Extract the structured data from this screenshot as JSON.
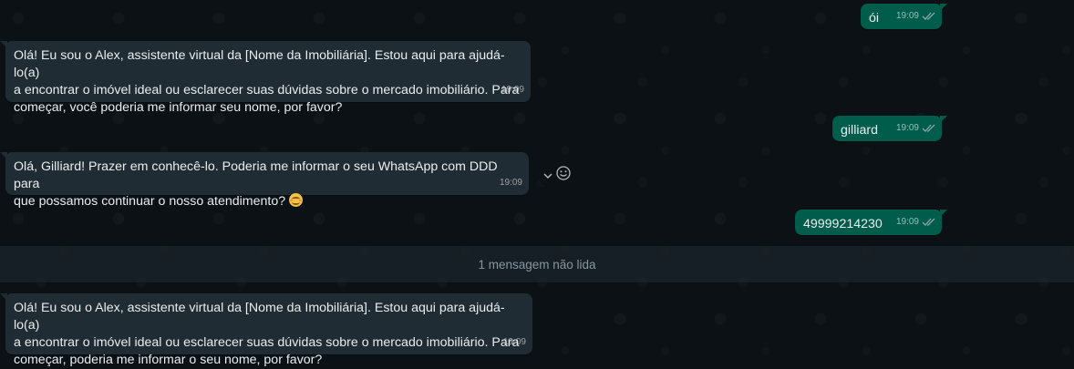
{
  "messages": [
    {
      "id": "out1",
      "direction": "out",
      "text": "ói",
      "time": "19:09",
      "status_icon": "double-check-icon"
    },
    {
      "id": "in1",
      "direction": "in",
      "text": "Olá! Eu sou o Alex, assistente virtual da [Nome da Imobiliária]. Estou aqui para ajudá-lo(a)\na encontrar o imóvel ideal ou esclarecer suas dúvidas sobre o mercado imobiliário. Para\ncomeçar, você poderia me informar seu nome, por favor?",
      "time": "19:09"
    },
    {
      "id": "out2",
      "direction": "out",
      "text": "gilliard",
      "time": "19:09",
      "status_icon": "double-check-icon"
    },
    {
      "id": "in2",
      "direction": "in",
      "text": "Olá, Gilliard! Prazer em conhecê-lo. Poderia me informar o seu WhatsApp com DDD para\nque possamos continuar o nosso atendimento?",
      "emoji": "smiling-face-emoji",
      "time": "19:09"
    },
    {
      "id": "out3",
      "direction": "out",
      "text": "49999214230",
      "time": "19:09",
      "status_icon": "double-check-icon"
    },
    {
      "id": "in3",
      "direction": "in",
      "text": "Olá! Eu sou o Alex, assistente virtual da [Nome da Imobiliária]. Estou aqui para ajudá-lo(a)\na encontrar o imóvel ideal ou esclarecer suas dúvidas sobre o mercado imobiliário. Para\ncomeçar, poderia me informar o seu nome, por favor?",
      "time": "19:09"
    }
  ],
  "unread_divider": {
    "label": "1 mensagem não lida"
  },
  "hover_actions": {
    "menu_icon": "chevron-down-icon",
    "react_icon": "emoji-icon"
  },
  "colors": {
    "background": "#0b1114",
    "incoming_bubble": "#202c33",
    "outgoing_bubble": "#005c4b",
    "text": "#e9edef",
    "meta_text": "#8696a0"
  }
}
